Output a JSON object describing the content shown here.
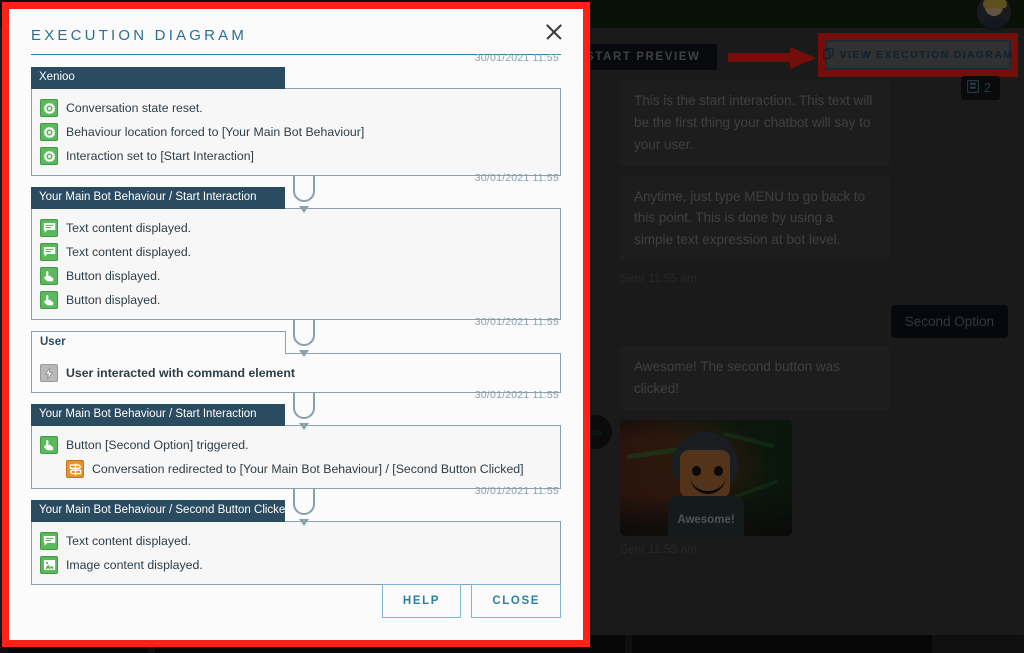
{
  "background": {
    "avatar": "user-avatar",
    "toolbar": {
      "start_preview_label": "START PREVIEW",
      "view_diagram_label": "VIEW EXECUTION DIAGRAM",
      "view_diagram_icon": "diagram-icon",
      "highlight_color": "#ff2018"
    },
    "badge": {
      "icon": "transcript-icon",
      "count": "2"
    },
    "chat": {
      "messages": [
        {
          "from": "bot",
          "text": "This is the start interaction.\nThis text will be the first thing your chatbot will say to your user."
        },
        {
          "from": "bot",
          "text": "Anytime, just type MENU to go back to this point. This is done by using a simple text expression at bot level."
        },
        {
          "from": "bot",
          "meta": "Sent 11:55 am"
        },
        {
          "from": "user",
          "text": "Second Option"
        },
        {
          "from": "bot",
          "text": "Awesome! The second button was clicked!"
        },
        {
          "from": "bot",
          "image_caption": "Awesome!"
        },
        {
          "from": "bot",
          "meta": "Sent 11:55 am"
        }
      ],
      "sent_label_1": "Sent 11:55 am",
      "sent_label_2": "Sent 11:55 am",
      "bot_msg_1": "This is the start interaction.\nThis text will be the first thing your chatbot will say to your user.",
      "bot_msg_2": "Anytime, just type MENU to go back to this point. This is done by using a simple text expression at bot level.",
      "user_msg_1": "Second Option",
      "bot_msg_3": "Awesome! The second button was clicked!",
      "image_caption": "Awesome!"
    }
  },
  "modal": {
    "title": "EXECUTION DIAGRAM",
    "close_icon": "close-icon",
    "accent_color": "#2c80a8",
    "highlight_color": "#ff2018",
    "footer": {
      "help_label": "HELP",
      "close_label": "CLOSE"
    },
    "steps": [
      {
        "header": "Xenioo",
        "timestamp": "30/01/2021 11:55",
        "header_style": "dark",
        "rows": [
          {
            "icon": "gear-icon",
            "icon_color": "green",
            "text": "Conversation state reset."
          },
          {
            "icon": "gear-icon",
            "icon_color": "green",
            "text": "Behaviour location forced to [Your Main Bot Behaviour]"
          },
          {
            "icon": "gear-icon",
            "icon_color": "green",
            "text": "Interaction set to [Start Interaction]"
          }
        ]
      },
      {
        "header": "Your Main Bot Behaviour / Start Interaction",
        "timestamp": "30/01/2021 11:55",
        "header_style": "dark",
        "rows": [
          {
            "icon": "text-message-icon",
            "icon_color": "green",
            "text": "Text content displayed."
          },
          {
            "icon": "text-message-icon",
            "icon_color": "green",
            "text": "Text content displayed."
          },
          {
            "icon": "button-click-icon",
            "icon_color": "green",
            "text": "Button displayed."
          },
          {
            "icon": "button-click-icon",
            "icon_color": "green",
            "text": "Button displayed."
          }
        ]
      },
      {
        "header": "User",
        "timestamp": "30/01/2021 11:55",
        "header_style": "light",
        "rows": [
          {
            "icon": "lightning-icon",
            "icon_color": "grey",
            "text": "User interacted with command element",
            "bold": true
          }
        ]
      },
      {
        "header": "Your Main Bot Behaviour / Start Interaction",
        "timestamp": "30/01/2021 11:55",
        "header_style": "dark",
        "rows": [
          {
            "icon": "button-click-icon",
            "icon_color": "green",
            "text": "Button [Second Option] triggered."
          },
          {
            "icon": "redirect-icon",
            "icon_color": "orange",
            "text": "Conversation redirected to [Your Main Bot Behaviour] / [Second Button Clicked]",
            "indent": true
          }
        ]
      },
      {
        "header": "Your Main Bot Behaviour / Second Button Clicked",
        "timestamp": "30/01/2021 11:55",
        "header_style": "dark",
        "rows": [
          {
            "icon": "text-message-icon",
            "icon_color": "green",
            "text": "Text content displayed."
          },
          {
            "icon": "image-icon",
            "icon_color": "green",
            "text": "Image content displayed."
          }
        ]
      }
    ]
  }
}
